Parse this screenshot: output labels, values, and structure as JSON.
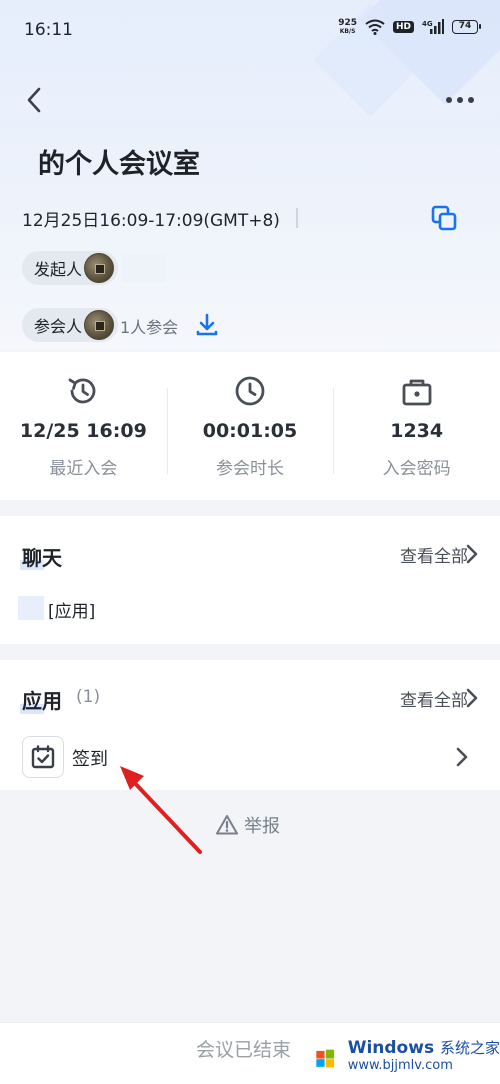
{
  "status_bar": {
    "time": "16:11",
    "net_speed_value": "925",
    "net_speed_unit": "KB/S",
    "hd_label": "HD",
    "network_label": "4G",
    "battery": "74"
  },
  "header": {
    "back_icon": "chevron-left-icon",
    "more_icon": "more-dots-icon"
  },
  "meeting": {
    "title": "的个人会议室",
    "time": "12月25日16:09-17:09(GMT+8)",
    "copy_icon": "copy-icon",
    "host_label": "发起人",
    "attendee_label": "参会人",
    "attendee_count": "1人参会",
    "download_icon": "download-icon"
  },
  "stats": [
    {
      "icon": "history-clock-icon",
      "value": "12/25 16:09",
      "label": "最近入会"
    },
    {
      "icon": "clock-icon",
      "value": "00:01:05",
      "label": "参会时长"
    },
    {
      "icon": "lock-bag-icon",
      "value": "1234",
      "label": "入会密码"
    }
  ],
  "chat": {
    "title": "聊天",
    "view_all": "查看全部",
    "preview": "[应用]"
  },
  "apps": {
    "title": "应用",
    "count": "(1)",
    "view_all": "查看全部",
    "items": [
      {
        "icon": "calendar-check-icon",
        "label": "签到"
      }
    ]
  },
  "report": {
    "icon": "warning-triangle-icon",
    "label": "举报"
  },
  "bottom": {
    "status": "会议已结束"
  },
  "watermark": {
    "title": "Windows",
    "title_cn": "系统之家",
    "url": "www.bjjmlv.com"
  },
  "colors": {
    "accent": "#1a73e8",
    "annotation_arrow": "#e02020",
    "page_bg": "#f2f4f8"
  }
}
